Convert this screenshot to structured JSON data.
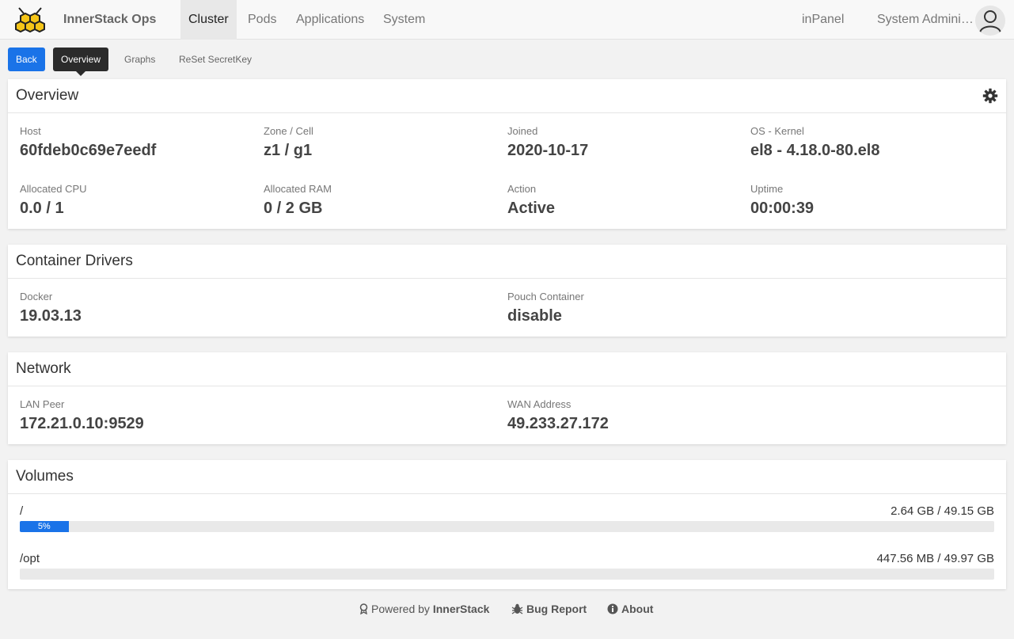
{
  "app": {
    "title": "InnerStack Ops"
  },
  "nav": {
    "items": [
      {
        "label": "Cluster",
        "active": true
      },
      {
        "label": "Pods"
      },
      {
        "label": "Applications"
      },
      {
        "label": "System"
      }
    ],
    "panel_link": "inPanel",
    "user_name": "System Administrator"
  },
  "subnav": {
    "back": "Back",
    "overview": "Overview",
    "graphs": "Graphs",
    "reset": "ReSet SecretKey"
  },
  "overview": {
    "title": "Overview",
    "fields": [
      {
        "label": "Host",
        "value": "60fdeb0c69e7eedf"
      },
      {
        "label": "Zone / Cell",
        "value": "z1 / g1"
      },
      {
        "label": "Joined",
        "value": "2020-10-17"
      },
      {
        "label": "OS - Kernel",
        "value": "el8 - 4.18.0-80.el8"
      },
      {
        "label": "Allocated CPU",
        "value": "0.0 / 1"
      },
      {
        "label": "Allocated RAM",
        "value": "0 / 2 GB"
      },
      {
        "label": "Action",
        "value": "Active"
      },
      {
        "label": "Uptime",
        "value": "00:00:39"
      }
    ]
  },
  "drivers": {
    "title": "Container Drivers",
    "fields": [
      {
        "label": "Docker",
        "value": "19.03.13"
      },
      {
        "label": "Pouch Container",
        "value": "disable"
      }
    ]
  },
  "network": {
    "title": "Network",
    "fields": [
      {
        "label": "LAN Peer",
        "value": "172.21.0.10:9529"
      },
      {
        "label": "WAN Address",
        "value": "49.233.27.172"
      }
    ]
  },
  "volumes": {
    "title": "Volumes",
    "items": [
      {
        "name": "/",
        "size": "2.64 GB / 49.15 GB",
        "percent": 5,
        "percent_label": "5%"
      },
      {
        "name": "/opt",
        "size": "447.56 MB / 49.97 GB",
        "percent": 0,
        "percent_label": ""
      }
    ]
  },
  "footer": {
    "powered_prefix": "Powered by",
    "powered_brand": "InnerStack",
    "bug_report": "Bug Report",
    "about": "About"
  },
  "colors": {
    "primary": "#1a73e8",
    "logo_fill": "#f5c518"
  }
}
